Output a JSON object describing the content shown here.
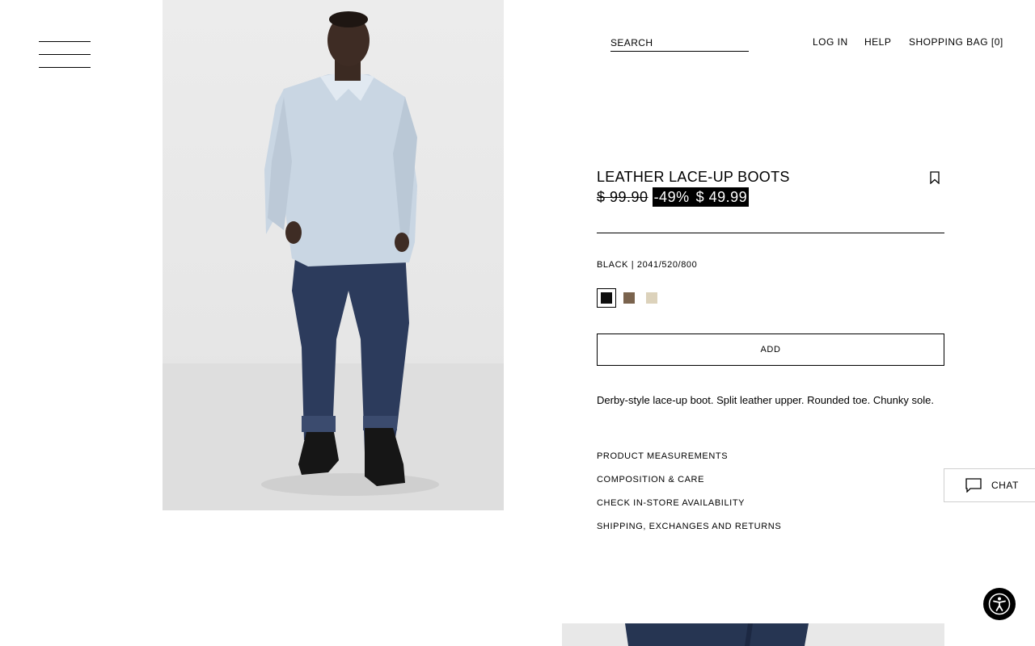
{
  "header": {
    "search_placeholder": "SEARCH",
    "login": "LOG IN",
    "help": "HELP",
    "bag": "SHOPPING BAG [0]"
  },
  "product": {
    "name": "LEATHER LACE-UP BOOTS",
    "old_price": "$ 99.90",
    "discount": "-49%",
    "price": "$ 49.99",
    "color_name": "BLACK",
    "reference": "2041/520/800",
    "swatches": [
      {
        "name": "black",
        "color": "#0d0d0d",
        "selected": true
      },
      {
        "name": "brown",
        "color": "#7a634d",
        "selected": false
      },
      {
        "name": "beige",
        "color": "#dcd2bb",
        "selected": false
      }
    ],
    "add_label": "ADD",
    "description": "Derby-style lace-up boot. Split leather upper. Rounded toe. Chunky sole.",
    "links": [
      "PRODUCT MEASUREMENTS",
      "COMPOSITION & CARE",
      "CHECK IN-STORE AVAILABILITY",
      "SHIPPING, EXCHANGES AND RETURNS"
    ]
  },
  "chat": {
    "label": "CHAT"
  },
  "icons": {
    "menu": "hamburger-icon",
    "bookmark": "bookmark-icon",
    "chat": "chat-bubble-icon",
    "accessibility": "accessibility-icon"
  },
  "colors": {
    "text": "#000000",
    "background": "#ffffff",
    "sale_bg": "#000000",
    "sale_text": "#ffffff"
  }
}
